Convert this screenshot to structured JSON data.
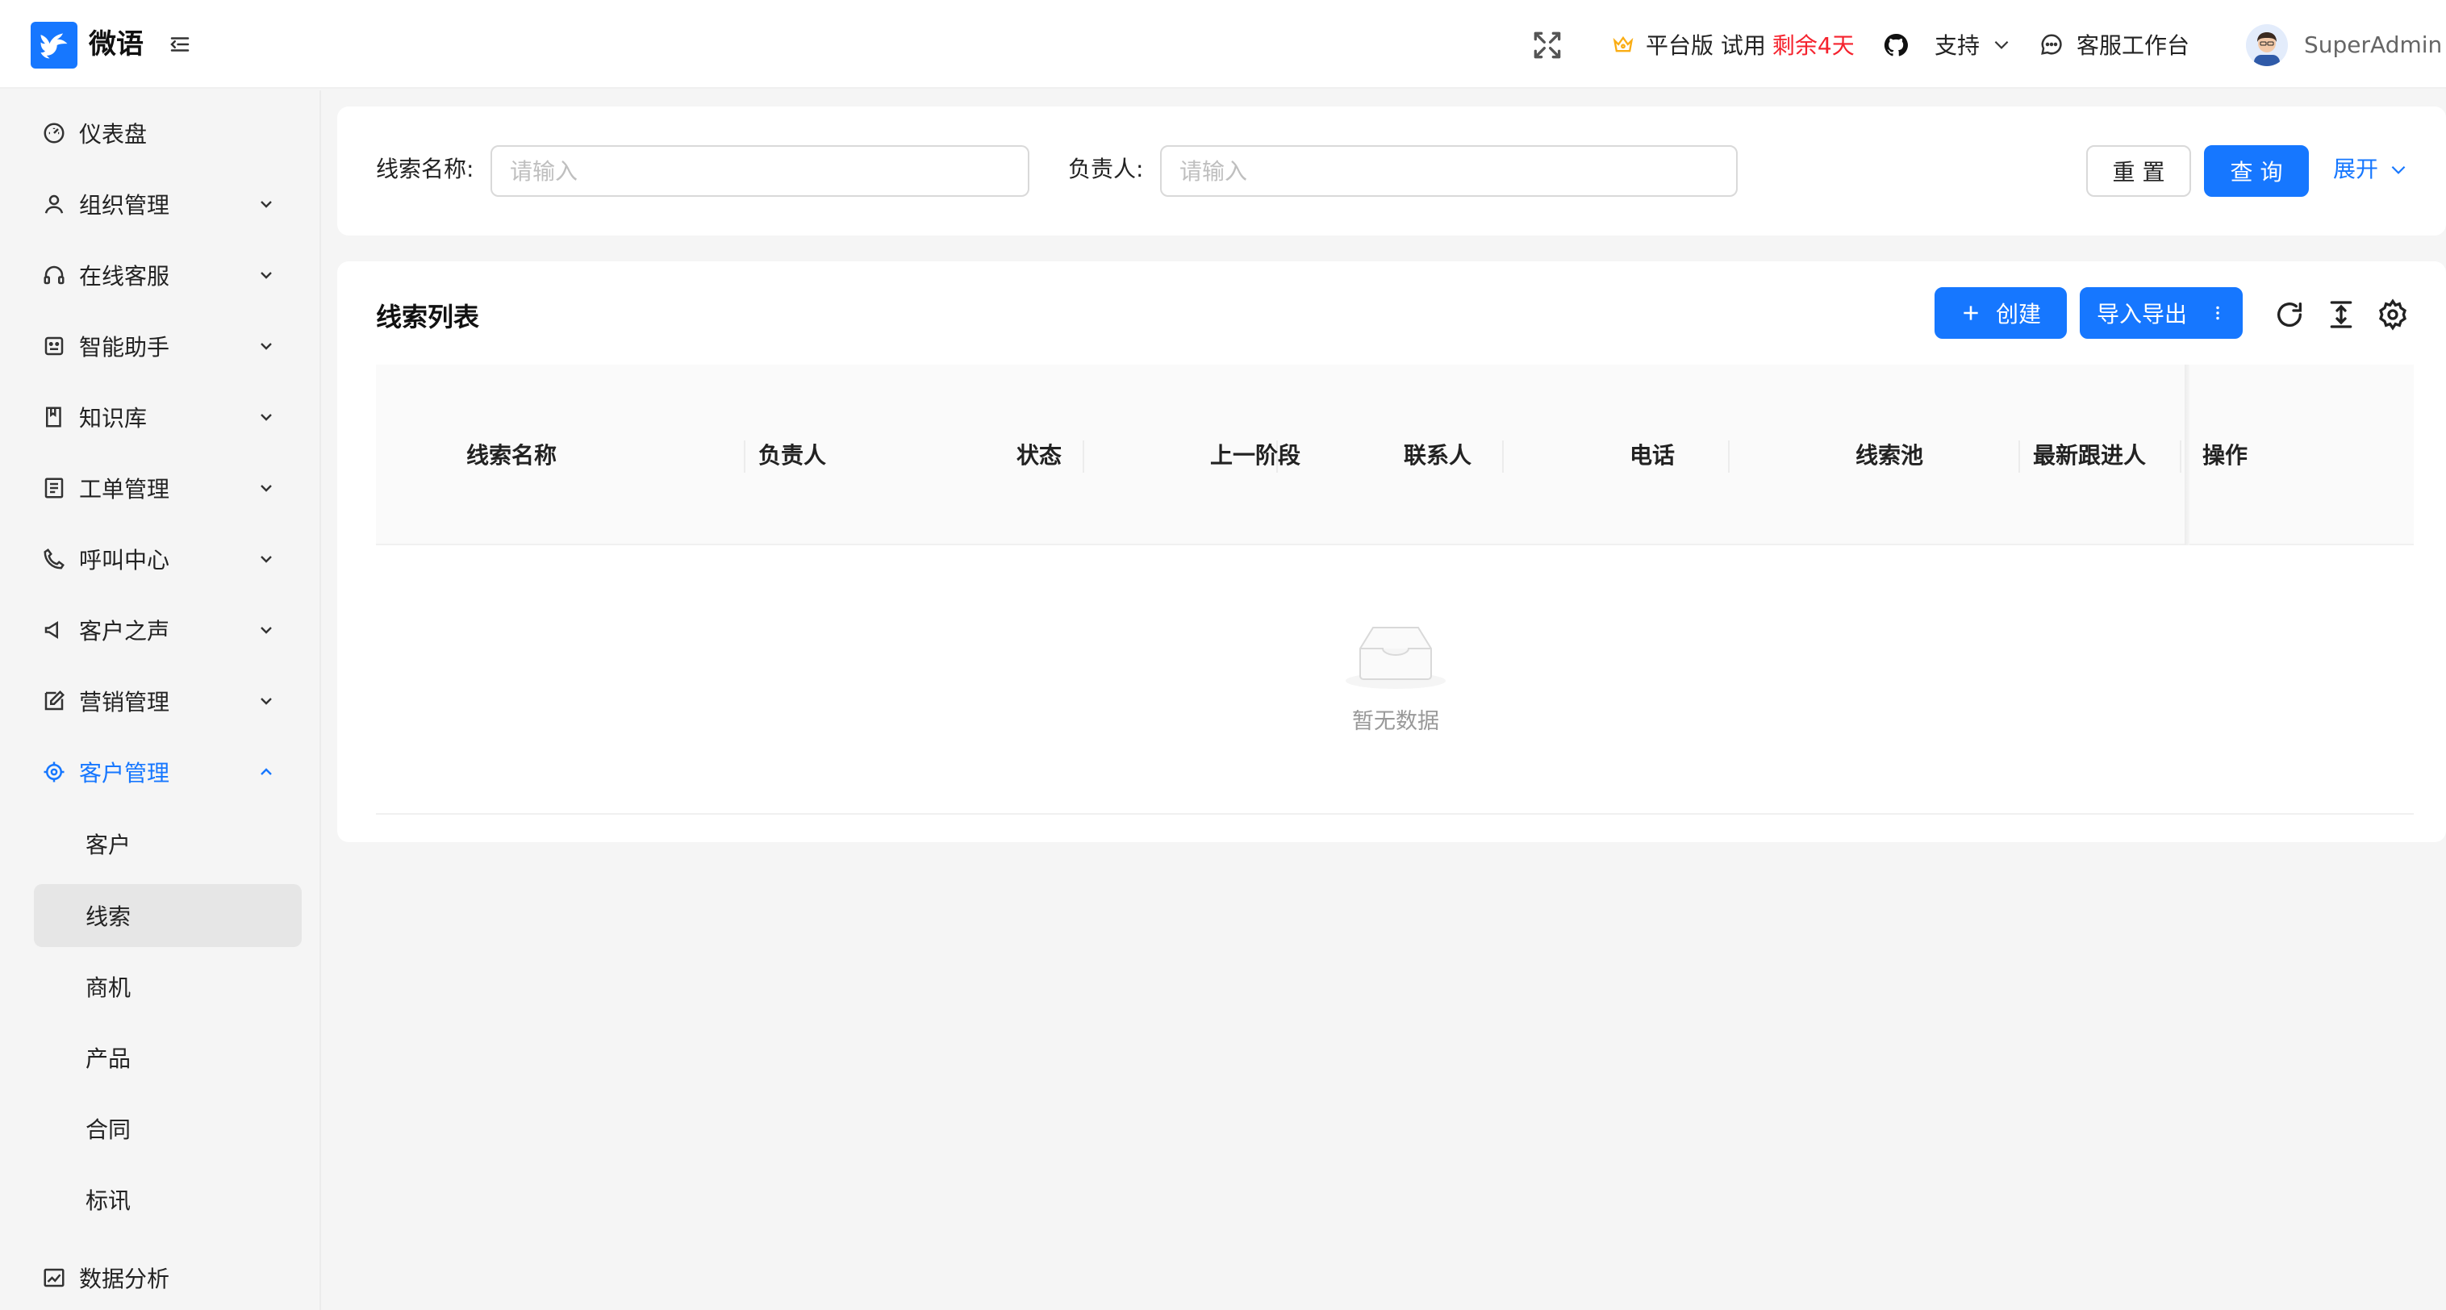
{
  "header": {
    "app_name": "微语",
    "trial_plan": "平台版 试用",
    "trial_remaining": "剩余4天",
    "support_label": "支持",
    "workbench_label": "客服工作台",
    "username": "SuperAdmin"
  },
  "sidebar": {
    "menu": [
      {
        "label": "仪表盘"
      },
      {
        "label": "组织管理"
      },
      {
        "label": "在线客服"
      },
      {
        "label": "智能助手"
      },
      {
        "label": "知识库"
      },
      {
        "label": "工单管理"
      },
      {
        "label": "呼叫中心"
      },
      {
        "label": "客户之声"
      },
      {
        "label": "营销管理"
      },
      {
        "label": "客户管理"
      },
      {
        "label": "数据分析"
      }
    ],
    "customer_submenu": [
      {
        "label": "客户"
      },
      {
        "label": "线索"
      },
      {
        "label": "商机"
      },
      {
        "label": "产品"
      },
      {
        "label": "合同"
      },
      {
        "label": "标讯"
      }
    ]
  },
  "search": {
    "name_label": "线索名称:",
    "name_placeholder": "请输入",
    "owner_label": "负责人:",
    "owner_placeholder": "请输入",
    "reset_label": "重 置",
    "query_label": "查 询",
    "expand_label": "展开"
  },
  "table": {
    "title": "线索列表",
    "create_label": "创建",
    "import_export_label": "导入导出",
    "columns": [
      "线索名称",
      "负责人",
      "状态",
      "上一阶段",
      "联系人",
      "电话",
      "线索池",
      "最新跟进人",
      "操作"
    ],
    "empty_text": "暂无数据"
  },
  "colors": {
    "primary": "#1677ff",
    "trial_remaining": "#f5222d",
    "trial_icon": "#faad14"
  }
}
